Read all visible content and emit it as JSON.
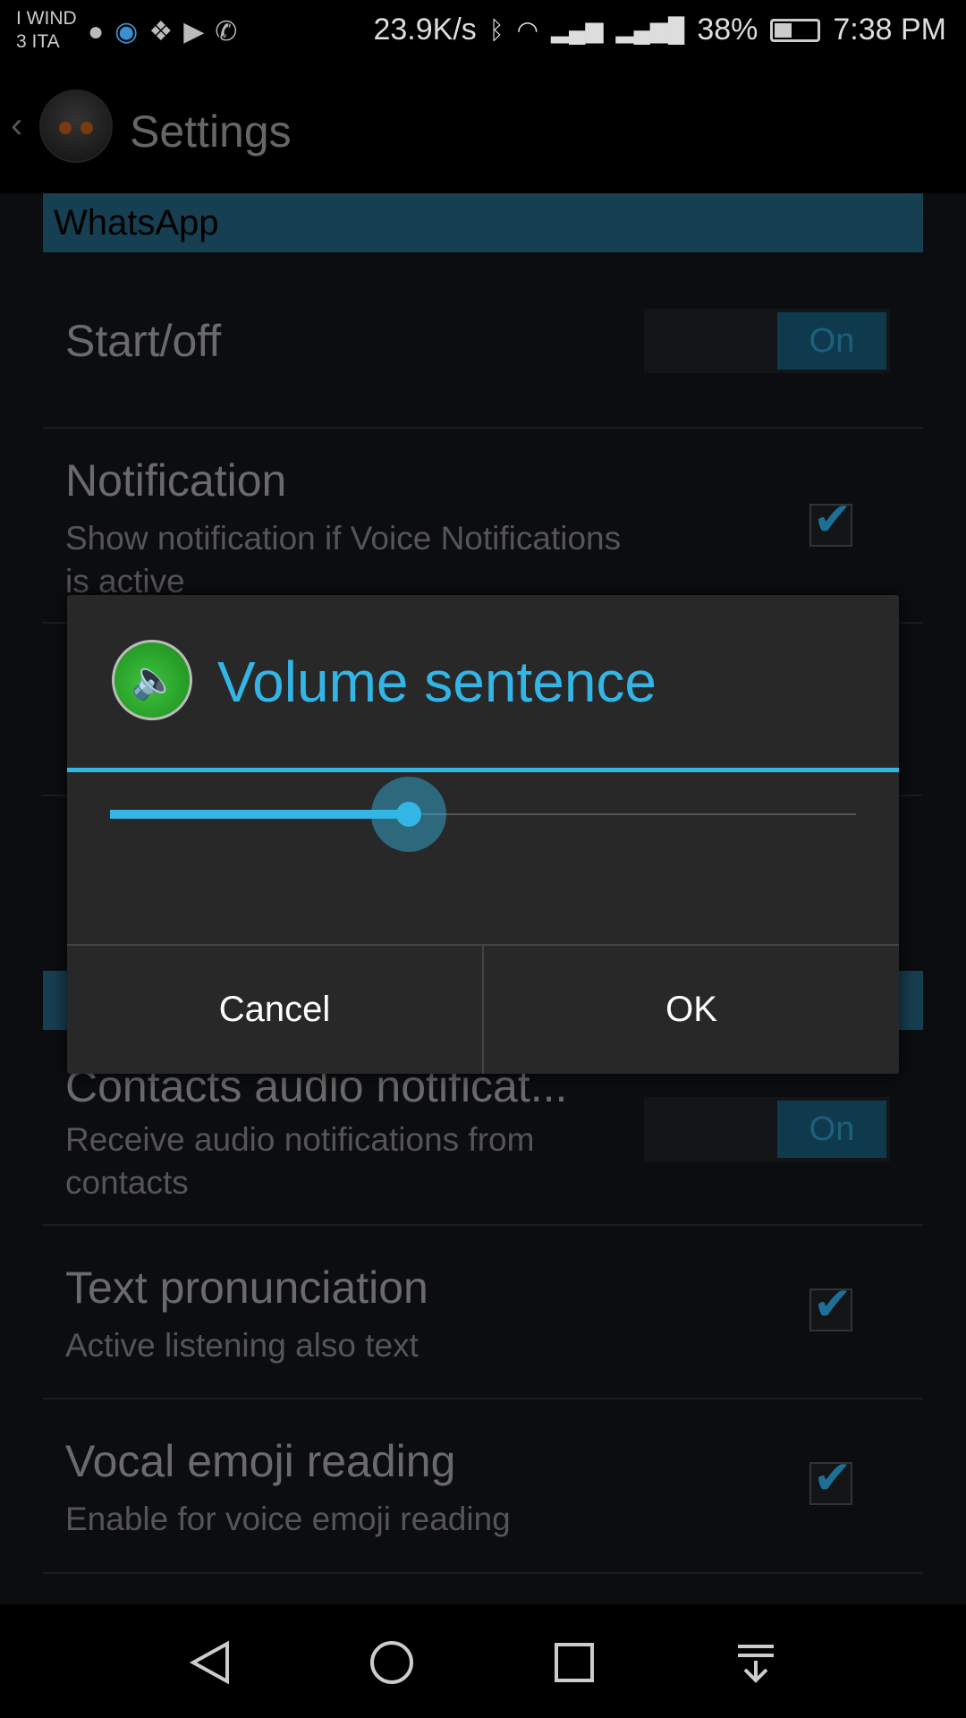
{
  "status_bar": {
    "carrier_line1": "I WIND",
    "carrier_line2": "3 ITA",
    "net_speed": "23.9K/s",
    "battery_percent": "38%",
    "time": "7:38 PM",
    "notification_icons": [
      "gorilla-app-icon",
      "bluetooth-app-icon",
      "dropbox-icon",
      "play-store-icon",
      "whatsapp-icon"
    ]
  },
  "action_bar": {
    "title": "Settings"
  },
  "settings": {
    "section1": "WhatsApp",
    "start_off": {
      "title": "Start/off",
      "toggle": "On"
    },
    "notification": {
      "title": "Notification",
      "subtitle_line1": "Show notification if Voice Notifications",
      "subtitle_line2": "is active",
      "checked": true
    },
    "contacts_audio": {
      "title": "Contacts audio notificat...",
      "subtitle_line1": "Receive audio notifications from",
      "subtitle_line2": "contacts",
      "toggle": "On"
    },
    "text_pronunciation": {
      "title": "Text pronunciation",
      "subtitle": "Active listening also text",
      "checked": true
    },
    "vocal_emoji": {
      "title": "Vocal emoji reading",
      "subtitle": "Enable for voice emoji reading",
      "checked": true
    }
  },
  "dialog": {
    "title": "Volume sentence",
    "slider_value_fraction": 0.4,
    "cancel": "Cancel",
    "ok": "OK",
    "accent": "#33b5e5"
  }
}
